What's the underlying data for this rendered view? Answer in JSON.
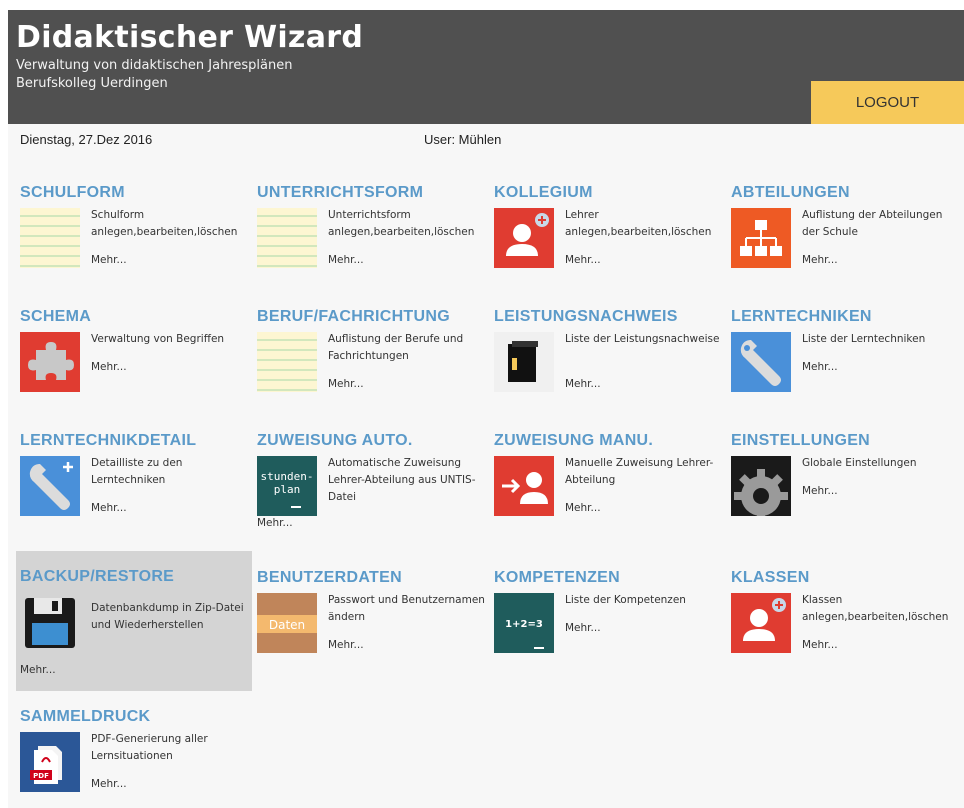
{
  "header": {
    "title": "Didaktischer Wizard",
    "subtitle_line1": "Verwaltung von didaktischen Jahresplänen",
    "subtitle_line2": "Berufskolleg Uerdingen",
    "logout_label": "LOGOUT"
  },
  "status": {
    "date": "Dienstag, 27.Dez 2016",
    "user": "User: Mühlen"
  },
  "colors": {
    "header_bg": "#505050",
    "logout_bg": "#f6c95a",
    "title_blue": "#5b9ac9"
  },
  "tiles": [
    {
      "title": "SCHULFORM",
      "desc": "Schulform anlegen,bearbeiten,löschen",
      "more": "Mehr...",
      "icon": "lined-paper-icon"
    },
    {
      "title": "UNTERRICHTSFORM",
      "desc": "Unterrichtsform anlegen,bearbeiten,löschen",
      "more": "Mehr...",
      "icon": "lined-paper-icon"
    },
    {
      "title": "KOLLEGIUM",
      "desc": "Lehrer anlegen,bearbeiten,löschen",
      "more": "Mehr...",
      "icon": "add-user-icon"
    },
    {
      "title": "ABTEILUNGEN",
      "desc": "Auflistung der Abteilungen der Schule",
      "more": "Mehr...",
      "icon": "org-chart-icon"
    },
    {
      "title": "SCHEMA",
      "desc": "Verwaltung von Begriffen",
      "more": "Mehr...",
      "icon": "puzzle-icon"
    },
    {
      "title": "BERUF/FACHRICHTUNG",
      "desc": "Auflistung der Berufe und Fachrichtungen",
      "more": "Mehr...",
      "icon": "lined-paper-icon"
    },
    {
      "title": "LEISTUNGSNACHWEIS",
      "desc": "Liste der Leistungsnachweise",
      "more": "Mehr...",
      "icon": "folder-icon"
    },
    {
      "title": "LERNTECHNIKEN",
      "desc": "Liste der Lerntechniken",
      "more": "Mehr...",
      "icon": "wrench-icon"
    },
    {
      "title": "LERNTECHNIKDETAIL",
      "desc": "Detailliste zu den Lerntechniken",
      "more": "Mehr...",
      "icon": "wrench-plus-icon"
    },
    {
      "title": "ZUWEISUNG AUTO.",
      "desc": "Automatische Zuweisung Lehrer-Abteilung aus UNTIS-Datei",
      "more": "Mehr...",
      "icon": "stundenplan-icon",
      "icon_text1": "stunden-",
      "icon_text2": "plan"
    },
    {
      "title": "ZUWEISUNG MANU.",
      "desc": "Manuelle Zuweisung Lehrer-Abteilung",
      "more": "Mehr...",
      "icon": "assign-user-icon"
    },
    {
      "title": "EINSTELLUNGEN",
      "desc": "Globale Einstellungen",
      "more": "Mehr...",
      "icon": "gear-icon"
    },
    {
      "title": "BACKUP/RESTORE",
      "desc": "Datenbankdump in Zip-Datei und Wiederherstellen",
      "more": "Mehr...",
      "icon": "floppy-disk-icon"
    },
    {
      "title": "BENUTZERDATEN",
      "desc": "Passwort und Benutzernamen ändern",
      "more": "Mehr...",
      "icon": "daten-icon",
      "icon_text": "Daten"
    },
    {
      "title": "KOMPETENZEN",
      "desc": "Liste der Kompetenzen",
      "more": "Mehr...",
      "icon": "calculator-icon",
      "icon_text": "1+2=3"
    },
    {
      "title": "KLASSEN",
      "desc": "Klassen anlegen,bearbeiten,löschen",
      "more": "Mehr...",
      "icon": "add-user-icon"
    },
    {
      "title": "SAMMELDRUCK",
      "desc": "PDF-Generierung aller Lernsituationen",
      "more": "Mehr...",
      "icon": "pdf-icon",
      "icon_text": "PDF"
    }
  ]
}
